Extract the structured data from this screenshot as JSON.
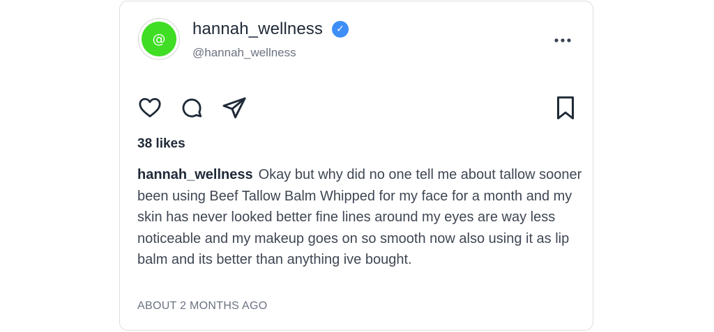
{
  "post": {
    "avatar_glyph": "@",
    "avatar_color": "#40dd25",
    "display_name": "hannah_wellness",
    "verified": true,
    "verified_glyph": "✓",
    "verified_color": "#3f8ef7",
    "handle": "@hannah_wellness",
    "more_icon": "ellipsis-horizontal-icon",
    "actions": {
      "like_icon": "heart-icon",
      "comment_icon": "comment-bubble-icon",
      "share_icon": "paper-plane-icon",
      "save_icon": "bookmark-icon"
    },
    "likes_text": "38 likes",
    "caption_author": "hannah_wellness",
    "caption_text": "Okay but why did no one tell me about tallow sooner been using Beef Tallow Balm Whipped for my face for a month and my skin has never looked better fine lines around my eyes are way less noticeable and my makeup goes on so smooth now also using it as lip balm and its better than anything ive bought.",
    "timestamp": "ABOUT 2 MONTHS AGO"
  }
}
